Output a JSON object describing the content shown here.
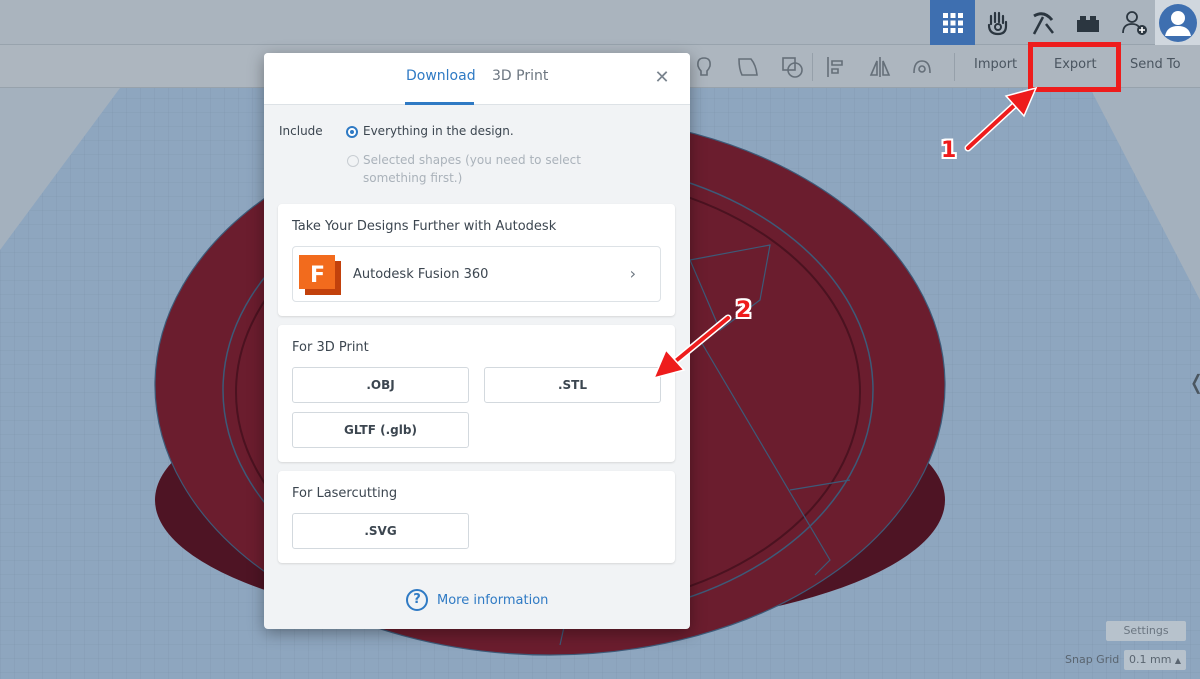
{
  "colors": {
    "accent": "#2f7ac4",
    "annotation_red": "#ee1c1c",
    "model_maroon": "#6b1d2e",
    "workplane": "#8fa3b8"
  },
  "toolbar": {
    "view_icons": [
      "grid-view-icon",
      "tinker-hand-icon",
      "pickaxe-icon",
      "bricks-icon",
      "add-user-icon"
    ],
    "import_label": "Import",
    "export_label": "Export",
    "send_to_label": "Send To"
  },
  "dialog": {
    "tabs": [
      {
        "label": "Download",
        "active": true
      },
      {
        "label": "3D Print",
        "active": false
      }
    ],
    "include_label": "Include",
    "options": [
      {
        "label": "Everything in the design.",
        "selected": true,
        "enabled": true
      },
      {
        "label": "Selected shapes (you need to select something first.)",
        "selected": false,
        "enabled": false
      }
    ],
    "autodesk_card": {
      "title": "Take Your Designs Further with Autodesk",
      "item_label": "Autodesk Fusion 360",
      "logo_letter": "F"
    },
    "print_card": {
      "title": "For 3D Print",
      "buttons": [
        ".OBJ",
        ".STL",
        "GLTF (.glb)"
      ]
    },
    "laser_card": {
      "title": "For Lasercutting",
      "buttons": [
        ".SVG"
      ]
    },
    "more_info_label": "More information",
    "more_info_icon": "?"
  },
  "annotations": [
    "1",
    "2"
  ],
  "bottom_right": {
    "settings_label": "Settings",
    "snap_grid_label": "Snap Grid",
    "snap_grid_value": "0.1 mm"
  }
}
